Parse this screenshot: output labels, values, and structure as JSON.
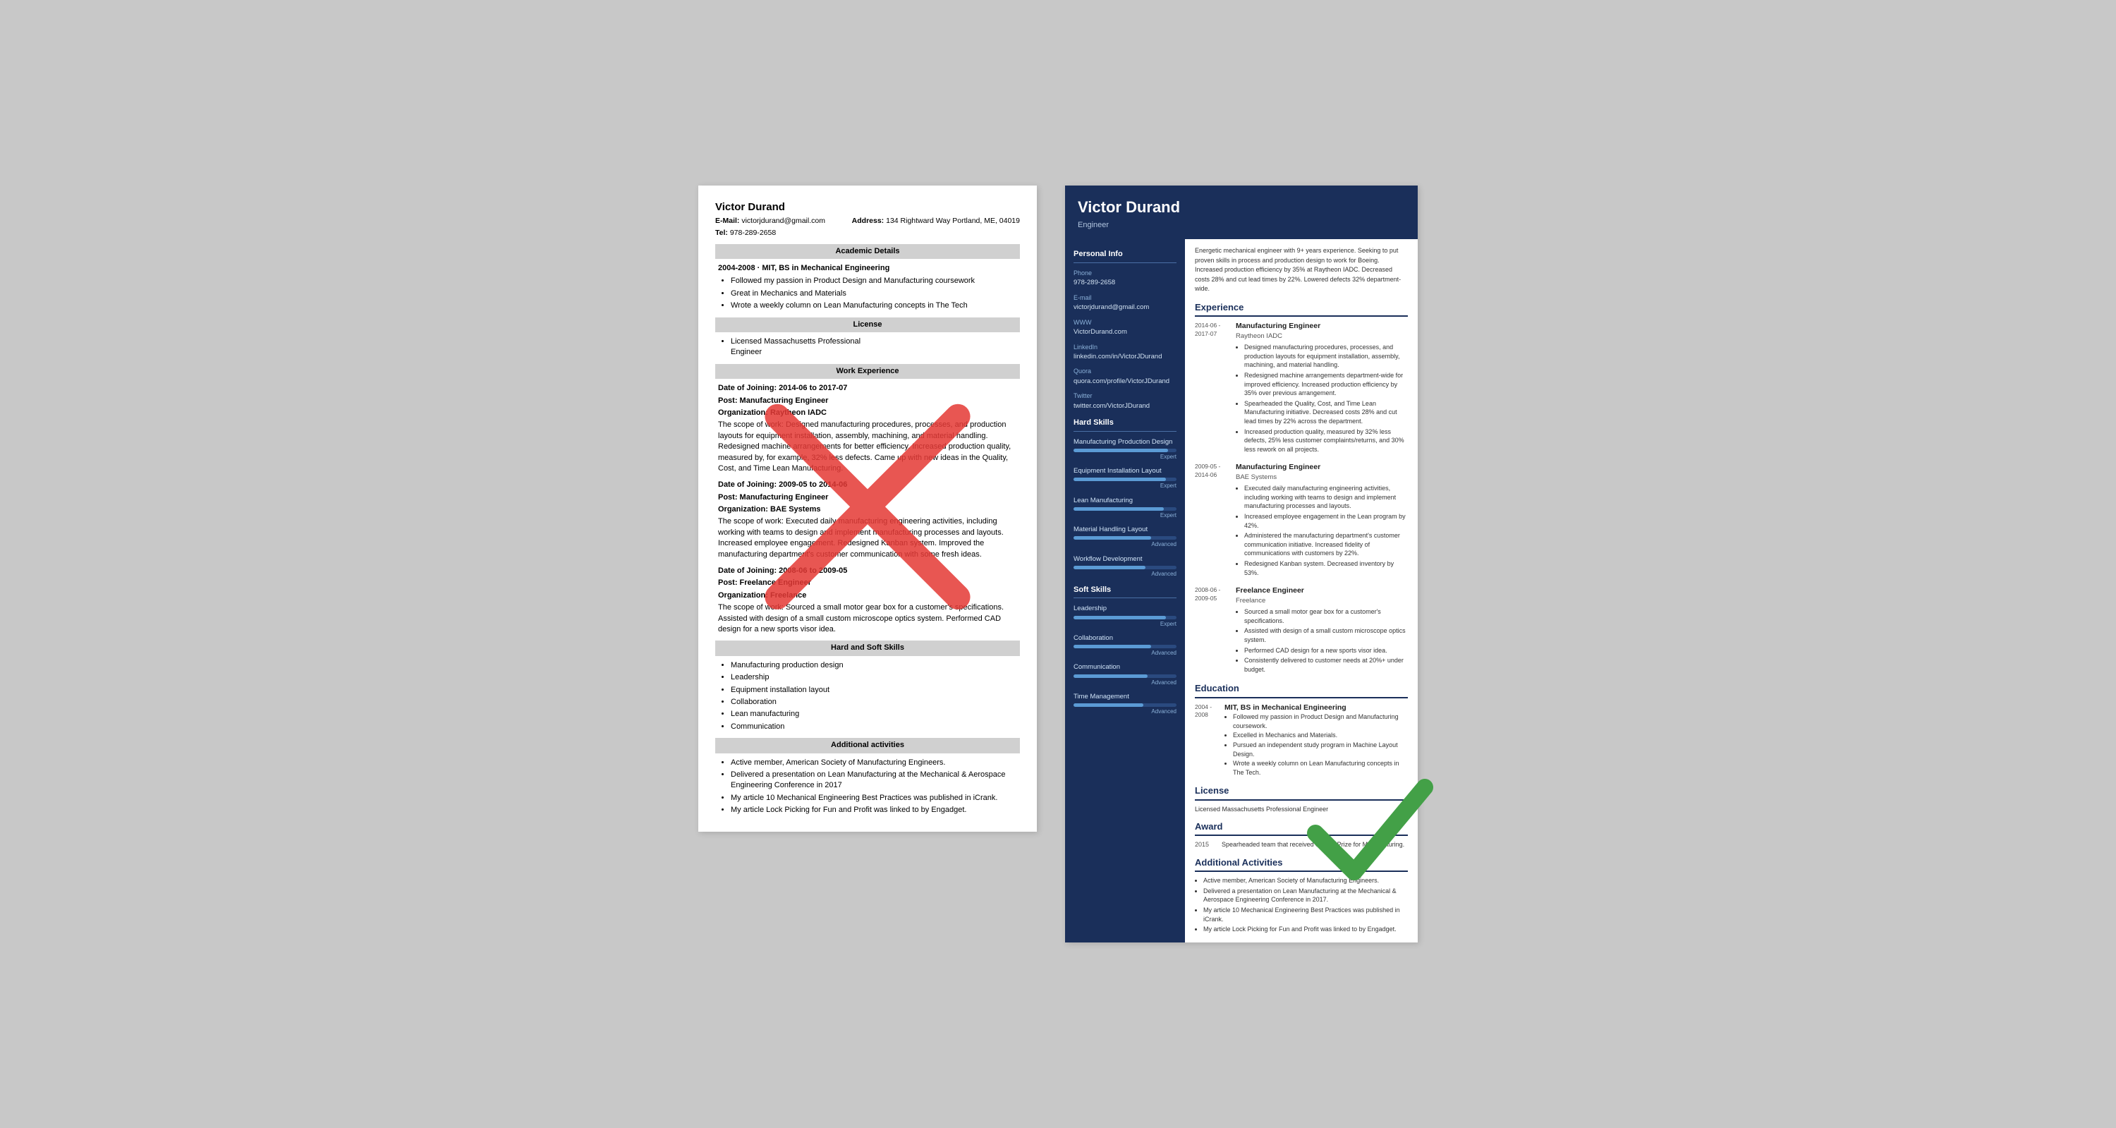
{
  "left_resume": {
    "name": "Victor Durand",
    "email_label": "E-Mail:",
    "email": "victorjdurand@gmail.com",
    "address_label": "Address:",
    "address": "134 Rightward Way Portland, ME, 04019",
    "tel_label": "Tel:",
    "tel": "978-289-2658",
    "sections": {
      "academic": {
        "title": "Academic Details",
        "degree": "2004-2008 · MIT, BS in Mechanical Engineering",
        "bullets": [
          "Followed my passion in Product Design and Manufacturing coursework",
          "Great in Mechanics and Materials",
          "Wrote a weekly column on Lean Manufacturing concepts in The Tech"
        ]
      },
      "license": {
        "title": "License",
        "text": "Licensed Massachusetts Professional\nEngineer"
      },
      "work": {
        "title": "Work Experience",
        "entries": [
          {
            "date": "Date of Joining: 2014-06 to 2017-07",
            "post": "Post: Manufacturing Engineer",
            "org": "Organization: Raytheon IADC",
            "scope": "The scope of work: Designed manufacturing procedures, processes, and production layouts for equipment installation, assembly, machining, and material handling. Redesigned machine arrangements for better efficiency. Increased production quality, measured by, for example, 32% less defects. Came up with new ideas in the Quality, Cost, and Time Lean Manufacturing."
          },
          {
            "date": "Date of Joining: 2009-05 to 2014-06",
            "post": "Post: Manufacturing Engineer",
            "org": "Organization: BAE Systems",
            "scope": "The scope of work: Executed daily manufacturing engineering activities, including working with teams to design and implement manufacturing processes and layouts. Increased employee engagement. Redesigned Kanban system. Improved the manufacturing department's customer communication with some fresh ideas."
          },
          {
            "date": "Date of Joining: 2008-06 to 2009-05",
            "post": "Post: Freelance Engineer",
            "org": "Organization: Freelance",
            "scope": "The scope of work: Sourced a small motor gear box for a customer's specifications. Assisted with design of a small custom microscope optics system. Performed CAD design for a new sports visor idea."
          }
        ]
      },
      "skills": {
        "title": "Hard and Soft Skills",
        "items": [
          "Manufacturing production design",
          "Leadership",
          "Equipment installation layout",
          "Collaboration",
          "Lean manufacturing",
          "Communication"
        ]
      },
      "additional": {
        "title": "Additional activities",
        "items": [
          "Active member, American Society of Manufacturing Engineers.",
          "Delivered a presentation on Lean Manufacturing at the Mechanical & Aerospace Engineering Conference in 2017",
          "My article 10 Mechanical Engineering Best Practices was published in iCrank.",
          "My article Lock Picking for Fun and Profit was linked to by Engadget."
        ]
      }
    }
  },
  "right_resume": {
    "name": "Victor Durand",
    "title": "Engineer",
    "summary": "Energetic mechanical engineer with 9+ years experience. Seeking to put proven skills in process and production design to work for Boeing. Increased production efficiency by 35% at Raytheon IADC. Decreased costs 28% and cut lead times by 22%. Lowered defects 32% department-wide.",
    "personal_info": {
      "section_title": "Personal Info",
      "fields": [
        {
          "label": "Phone",
          "value": "978-289-2658"
        },
        {
          "label": "E-mail",
          "value": "victorjdurand@gmail.com"
        },
        {
          "label": "WWW",
          "value": "VictorDurand.com"
        },
        {
          "label": "LinkedIn",
          "value": "linkedin.com/in/VictorJDurand"
        },
        {
          "label": "Quora",
          "value": "quora.com/profile/VictorJDurand"
        },
        {
          "label": "Twitter",
          "value": "twitter.com/VictorJDurand"
        }
      ]
    },
    "hard_skills": {
      "section_title": "Hard Skills",
      "items": [
        {
          "name": "Manufacturing Production Design",
          "level_label": "Expert",
          "level_pct": 92
        },
        {
          "name": "Equipment Installation Layout",
          "level_label": "Expert",
          "level_pct": 90
        },
        {
          "name": "Lean Manufacturing",
          "level_label": "Expert",
          "level_pct": 88
        },
        {
          "name": "Material Handling Layout",
          "level_label": "Advanced",
          "level_pct": 75
        },
        {
          "name": "Workflow Development",
          "level_label": "Advanced",
          "level_pct": 70
        }
      ]
    },
    "soft_skills": {
      "section_title": "Soft Skills",
      "items": [
        {
          "name": "Leadership",
          "level_label": "Expert",
          "level_pct": 90
        },
        {
          "name": "Collaboration",
          "level_label": "Advanced",
          "level_pct": 75
        },
        {
          "name": "Communication",
          "level_label": "Advanced",
          "level_pct": 72
        },
        {
          "name": "Time Management",
          "level_label": "Advanced",
          "level_pct": 68
        }
      ]
    },
    "experience": {
      "section_title": "Experience",
      "entries": [
        {
          "date": "2014-06 -\n2017-07",
          "title": "Manufacturing Engineer",
          "org": "Raytheon IADC",
          "bullets": [
            "Designed manufacturing procedures, processes, and production layouts for equipment installation, assembly, machining, and material handling.",
            "Redesigned machine arrangements department-wide for improved efficiency. Increased production efficiency by 35% over previous arrangement.",
            "Spearheaded the Quality, Cost, and Time Lean Manufacturing initiative. Decreased costs 28% and cut lead times by 22% across the department.",
            "Increased production quality, measured by 32% less defects, 25% less customer complaints/returns, and 30% less rework on all projects."
          ]
        },
        {
          "date": "2009-05 -\n2014-06",
          "title": "Manufacturing Engineer",
          "org": "BAE Systems",
          "bullets": [
            "Executed daily manufacturing engineering activities, including working with teams to design and implement manufacturing processes and layouts.",
            "Increased employee engagement in the Lean program by 42%.",
            "Administered the manufacturing department's customer communication initiative. Increased fidelity of communications with customers by 22%.",
            "Redesigned Kanban system. Decreased inventory by 53%."
          ]
        },
        {
          "date": "2008-06 -\n2009-05",
          "title": "Freelance Engineer",
          "org": "Freelance",
          "bullets": [
            "Sourced a small motor gear box for a customer's specifications.",
            "Assisted with design of a small custom microscope optics system.",
            "Performed CAD design for a new sports visor idea.",
            "Consistently delivered to customer needs at 20%+ under budget."
          ]
        }
      ]
    },
    "education": {
      "section_title": "Education",
      "entries": [
        {
          "date": "2004 -\n2008",
          "title": "MIT, BS in Mechanical Engineering",
          "bullets": [
            "Followed my passion in Product Design and Manufacturing coursework.",
            "Excelled in Mechanics and Materials.",
            "Pursued an independent study program in Machine Layout Design.",
            "Wrote a weekly column on Lean Manufacturing concepts in The Tech."
          ]
        }
      ]
    },
    "license": {
      "section_title": "License",
      "text": "Licensed Massachusetts Professional Engineer"
    },
    "award": {
      "section_title": "Award",
      "year": "2015",
      "text": "Spearheaded team that received Shingo Prize for Manufacturing."
    },
    "additional": {
      "section_title": "Additional Activities",
      "items": [
        "Active member, American Society of Manufacturing Engineers.",
        "Delivered a presentation on Lean Manufacturing at the Mechanical & Aerospace Engineering Conference in 2017.",
        "My article 10 Mechanical Engineering Best Practices was published in iCrank.",
        "My article Lock Picking for Fun and Profit was linked to by Engadget."
      ]
    }
  }
}
